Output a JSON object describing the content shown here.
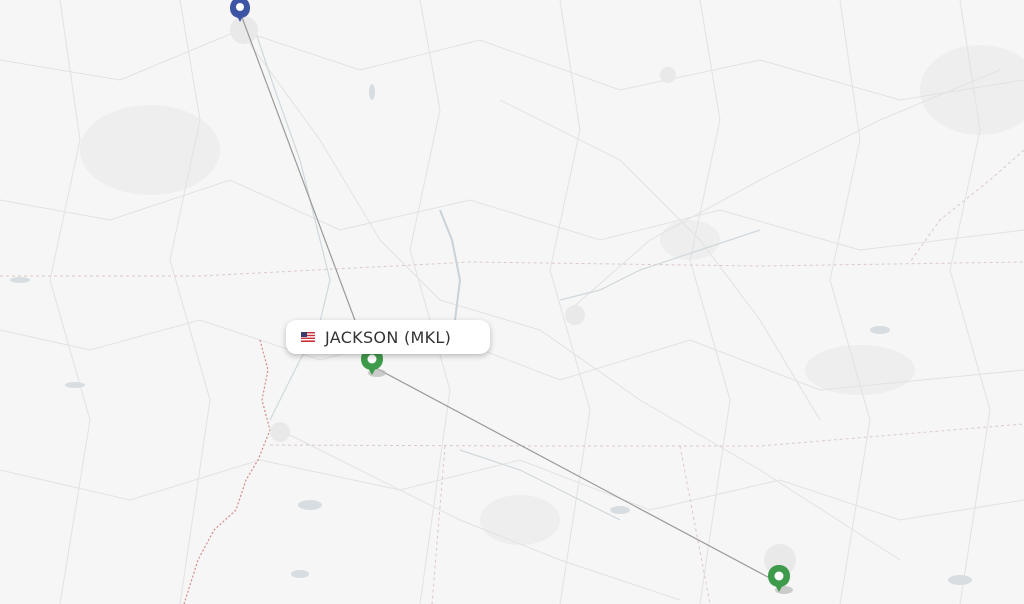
{
  "map": {
    "selected_airport": {
      "label": "JACKSON (MKL)",
      "country_flag_icon": "us-flag-icon"
    },
    "route_line_color": "#9a9a9a",
    "origin_marker_color": "#3c55a5",
    "destination_marker_color": "#3f9b4c",
    "background_color": "#f6f6f6"
  }
}
